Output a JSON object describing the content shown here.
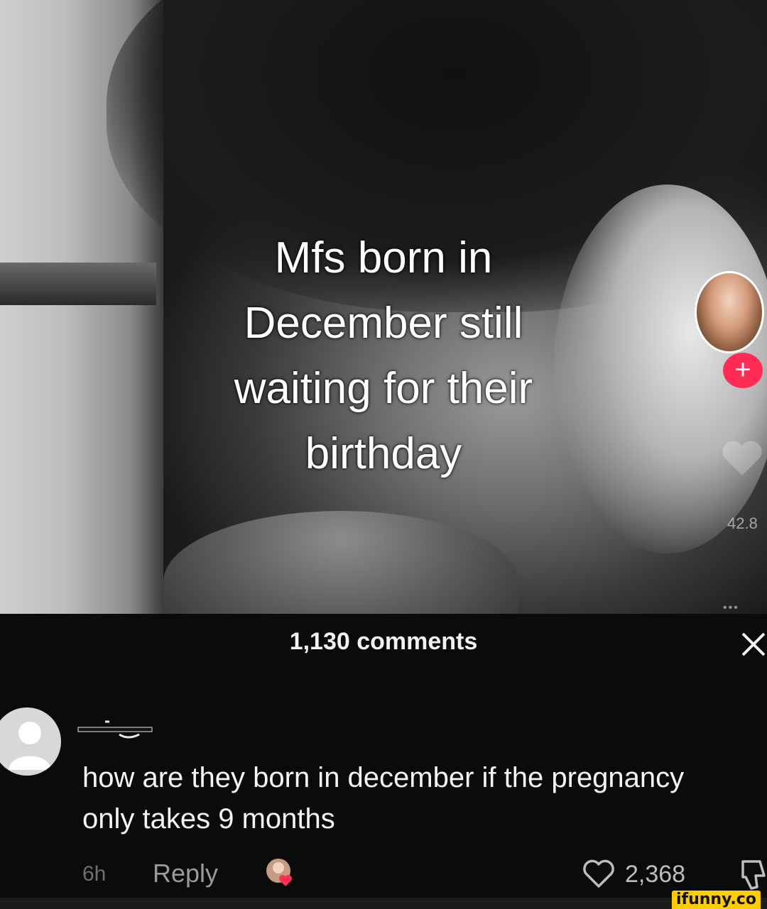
{
  "video": {
    "caption": "Mfs born in\nDecember still\nwaiting for their\nbirthday",
    "follow_icon": "plus-icon",
    "like_count_partial": "42.8"
  },
  "comments_sheet": {
    "title": "1,130 comments",
    "close_icon": "close-icon"
  },
  "comment": {
    "text": "how are they born in december if the pregnancy only takes 9 months",
    "time": "6h",
    "reply_label": "Reply",
    "like_count": "2,368",
    "like_icon": "heart-outline-icon",
    "dislike_icon": "thumbs-down-icon"
  },
  "watermark": {
    "text": "ifunny.co"
  },
  "colors": {
    "sheet_bg": "#0b0b0c",
    "follow_accent": "#ff2d55",
    "watermark_bg": "#ffcc00"
  }
}
